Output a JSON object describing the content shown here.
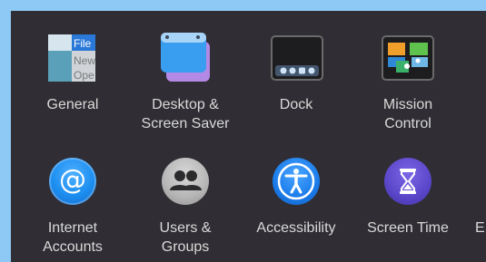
{
  "preferences": {
    "row1": [
      {
        "id": "general",
        "label_lines": [
          "General"
        ],
        "icon": "general-icon",
        "icon_text": [
          "File",
          "New",
          "Ope"
        ]
      },
      {
        "id": "desktop-screen-saver",
        "label_lines": [
          "Desktop &",
          "Screen Saver"
        ],
        "icon": "desktop-screensaver-icon"
      },
      {
        "id": "dock",
        "label_lines": [
          "Dock"
        ],
        "icon": "dock-icon"
      },
      {
        "id": "mission-control",
        "label_lines": [
          "Mission",
          "Control"
        ],
        "icon": "mission-control-icon"
      }
    ],
    "row2": [
      {
        "id": "internet-accounts",
        "label_lines": [
          "Internet",
          "Accounts"
        ],
        "icon": "at-sign-icon",
        "glyph": "@"
      },
      {
        "id": "users-groups",
        "label_lines": [
          "Users &",
          "Groups"
        ],
        "icon": "users-icon"
      },
      {
        "id": "accessibility",
        "label_lines": [
          "Accessibility"
        ],
        "icon": "accessibility-icon"
      },
      {
        "id": "screen-time",
        "label_lines": [
          "Screen Time"
        ],
        "icon": "hourglass-icon"
      },
      {
        "id": "extensions-partial",
        "label_lines": [
          "E"
        ]
      }
    ]
  },
  "colors": {
    "background": "#8ec8f4",
    "panel": "#302e34",
    "label": "#d9d9d9",
    "internet_accounts": "#1c8ef0",
    "users_groups": "#b5b5b5",
    "accessibility": "#1a7bea",
    "screen_time": "#5a46c9"
  }
}
